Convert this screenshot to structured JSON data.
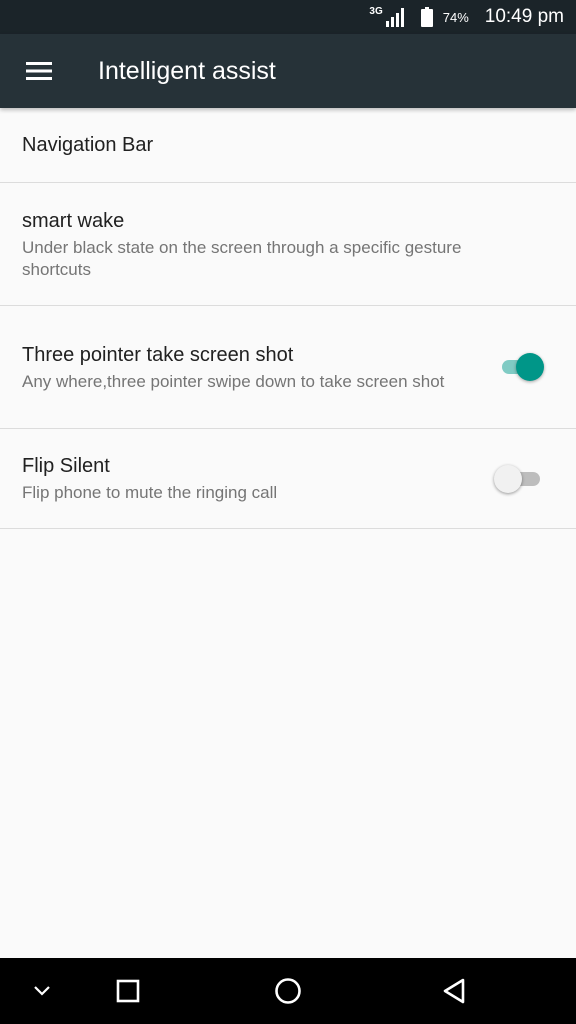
{
  "status_bar": {
    "network_type": "3G",
    "battery_percent": "74%",
    "time": "10:49 pm"
  },
  "app_bar": {
    "title": "Intelligent assist"
  },
  "settings": [
    {
      "title": "Navigation Bar"
    },
    {
      "title": "smart wake",
      "subtitle": "Under black state on the screen through a specific gesture shortcuts"
    },
    {
      "title": "Three pointer take screen shot",
      "subtitle": "Any where,three pointer swipe down to take screen shot",
      "toggle": true
    },
    {
      "title": "Flip Silent",
      "subtitle": "Flip phone to mute the ringing call",
      "toggle": false
    }
  ],
  "colors": {
    "status_bar": "#1b2429",
    "app_bar": "#263238",
    "accent": "#009688",
    "accent_track": "#80cbc4",
    "background": "#fafafa"
  },
  "icons": {
    "menu": "hamburger-menu-icon",
    "nav_hide": "chevron-down-icon",
    "nav_recents": "square-icon",
    "nav_home": "circle-icon",
    "nav_back": "triangle-back-icon"
  }
}
